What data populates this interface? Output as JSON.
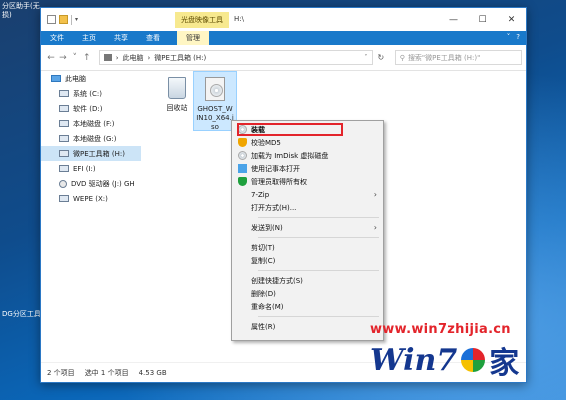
{
  "desktop": {
    "top_left_text": "分区助手(无损)",
    "bottom_left_text": "DG分区工具"
  },
  "window": {
    "title": "H:\\",
    "context_tab": "光盘映像工具",
    "controls": [
      "—",
      "☐",
      "✕"
    ]
  },
  "ribbon": {
    "tabs": [
      "文件",
      "主页",
      "共享",
      "查看"
    ],
    "manage": "管理",
    "right": [
      "˅",
      "?"
    ]
  },
  "address": {
    "back": "←",
    "forward": "→",
    "up_dd": "˅",
    "up": "↑",
    "breadcrumb": [
      "›",
      "此电脑",
      "›",
      "微PE工具箱 (H:)"
    ],
    "dropdown": "˅",
    "refresh": "↻",
    "search_placeholder": "搜索\"微PE工具箱 (H:)\""
  },
  "nav": [
    {
      "label": "此电脑",
      "icon": "computer-icon"
    },
    {
      "label": "系统 (C:)",
      "icon": "drive-icon"
    },
    {
      "label": "软件 (D:)",
      "icon": "drive-icon"
    },
    {
      "label": "本地磁盘 (F:)",
      "icon": "drive-icon"
    },
    {
      "label": "本地磁盘 (G:)",
      "icon": "drive-icon"
    },
    {
      "label": "微PE工具箱 (H:)",
      "icon": "drive-icon",
      "selected": true
    },
    {
      "label": "EFI (I:)",
      "icon": "drive-icon"
    },
    {
      "label": "DVD 驱动器 (J:) GH",
      "icon": "dvd-icon"
    },
    {
      "label": "WEPE (X:)",
      "icon": "drive-icon"
    }
  ],
  "files": [
    {
      "name": "回收站",
      "icon": "recycle-bin-icon"
    },
    {
      "name": "GHOST_WIN10_X64.iso",
      "display": "GHOST_W IN10_X64.i so",
      "icon": "iso-file-icon",
      "selected": true
    }
  ],
  "context_menu": {
    "items": [
      {
        "label": "装载",
        "icon": "disc-icon",
        "bold": true,
        "highlight": true
      },
      {
        "label": "校验MD5",
        "icon": "shield-icon"
      },
      {
        "label": "加载为 ImDisk 虚拟磁盘",
        "icon": "disc-icon"
      },
      {
        "label": "使用记事本打开",
        "icon": "notepad-icon"
      },
      {
        "label": "管理员取得所有权",
        "icon": "admin-icon"
      },
      {
        "label": "7-Zip",
        "submenu": true
      },
      {
        "label": "打开方式(H)..."
      },
      {
        "separator": true
      },
      {
        "label": "发送到(N)",
        "submenu": true
      },
      {
        "separator": true
      },
      {
        "label": "剪切(T)"
      },
      {
        "label": "复制(C)"
      },
      {
        "separator": true
      },
      {
        "label": "创建快捷方式(S)"
      },
      {
        "label": "删除(D)"
      },
      {
        "label": "重命名(M)"
      },
      {
        "separator": true
      },
      {
        "label": "属性(R)"
      }
    ]
  },
  "status": {
    "items_count": "2 个项目",
    "selected": "选中 1 个项目",
    "size": "4.53 GB"
  },
  "watermark": {
    "url": "www.win7zhijia.cn",
    "logo_text": "Win7",
    "logo_cn": "家"
  }
}
